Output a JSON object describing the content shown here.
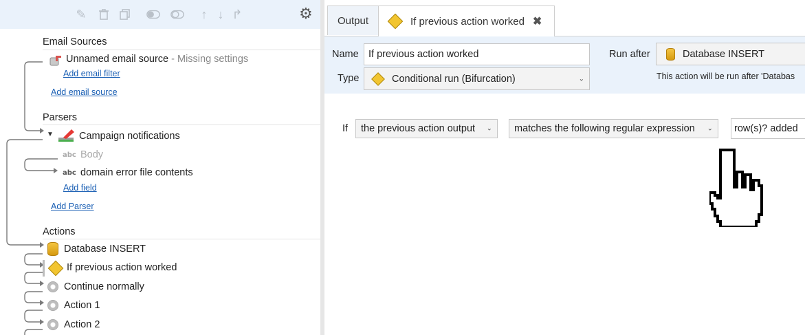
{
  "left": {
    "toolbar": {
      "icons": [
        "edit-icon",
        "delete-icon",
        "copy-icon",
        "toggle-on-icon",
        "toggle-off-icon",
        "move-up-icon",
        "move-down-icon",
        "redirect-icon",
        "settings-icon"
      ]
    },
    "email_sources": {
      "title": "Email Sources",
      "source_name": "Unnamed email source",
      "source_status": " - Missing settings",
      "add_filter": "Add email filter",
      "add_source": "Add email source"
    },
    "parsers": {
      "title": "Parsers",
      "parser_name": "Campaign notifications",
      "field_body": "Body",
      "field_domain": "domain error file contents",
      "field_tag": "abc",
      "add_field": "Add field",
      "add_parser": "Add Parser"
    },
    "actions": {
      "title": "Actions",
      "items": [
        "Database INSERT",
        "If previous action worked",
        "Continue normally",
        "Action 1",
        "Action 2"
      ]
    }
  },
  "right": {
    "tabs": {
      "output": "Output",
      "active": "If previous action worked",
      "close": "✖"
    },
    "props": {
      "name_label": "Name",
      "name_value": "If previous action worked",
      "type_label": "Type",
      "type_value": "Conditional run (Bifurcation)",
      "run_after_label": "Run after",
      "run_after_value": "Database INSERT",
      "run_after_hint": "This action will be run after 'Databas"
    },
    "condition": {
      "if_label": "If",
      "subject": "the previous action output",
      "operator": "matches the following regular expression",
      "value": "row(s)? added"
    }
  }
}
